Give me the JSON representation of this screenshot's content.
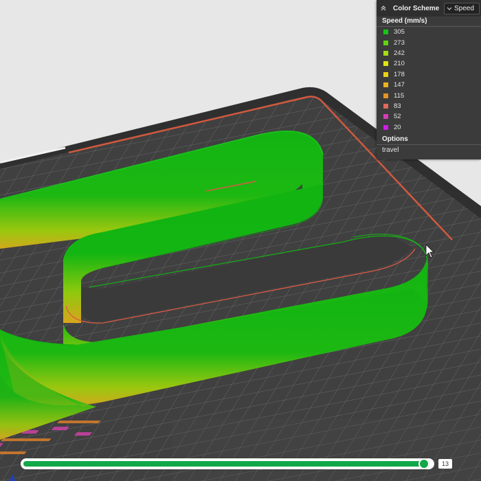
{
  "panel": {
    "title": "Color Scheme",
    "selected_scheme": "Speed",
    "speed_header": "Speed (mm/s)",
    "legend": [
      {
        "value": "305",
        "color": "#16c516"
      },
      {
        "value": "273",
        "color": "#5fd414"
      },
      {
        "value": "242",
        "color": "#a6dc12"
      },
      {
        "value": "210",
        "color": "#dce611"
      },
      {
        "value": "178",
        "color": "#ead215"
      },
      {
        "value": "147",
        "color": "#eab21d"
      },
      {
        "value": "115",
        "color": "#e79324"
      },
      {
        "value": "83",
        "color": "#dd6a5e"
      },
      {
        "value": "52",
        "color": "#d53cb9"
      },
      {
        "value": "20",
        "color": "#cf1ce8"
      }
    ],
    "options_header": "Options",
    "options": [
      "travel"
    ]
  },
  "slider": {
    "value": "13",
    "fraction": 0.988
  },
  "icons": {
    "collapse": "chevron-up-double-icon",
    "dropdown": "chevron-down-icon",
    "cursor": "mouse-pointer-icon"
  }
}
